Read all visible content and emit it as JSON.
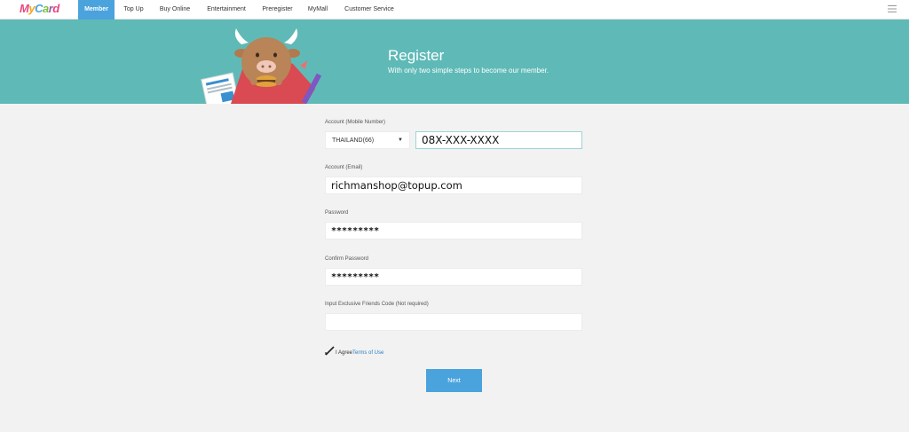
{
  "header": {
    "logo_text": "MyCard",
    "nav": [
      {
        "label": "Member",
        "active": true
      },
      {
        "label": "Top Up"
      },
      {
        "label": "Buy Online"
      },
      {
        "label": "Entertainment"
      },
      {
        "label": "Preregister"
      },
      {
        "label": "MyMall"
      },
      {
        "label": "Customer Service"
      }
    ],
    "menu_icon": "hamburger-icon"
  },
  "banner": {
    "title": "Register",
    "subtitle": "With only two simple steps to become our member.",
    "mascot_icon": "bull-mascot-icon"
  },
  "form": {
    "mobile": {
      "label": "Account (Mobile Number)",
      "country": "THAILAND(66)",
      "value": "08X-XXX-XXXX"
    },
    "email": {
      "label": "Account (Email)",
      "value": "richmanshop@topup.com"
    },
    "password": {
      "label": "Password",
      "value": "*********"
    },
    "confirm_password": {
      "label": "Confirm Password",
      "value": "*********"
    },
    "friends_code": {
      "label": "Input Exclusive Friends Code (Not required)",
      "value": ""
    },
    "agree": {
      "label": "I Agree",
      "link": "Terms of Use",
      "checked": true
    },
    "next_label": "Next"
  },
  "colors": {
    "accent": "#4aa3dc",
    "banner": "#5fbab7",
    "background": "#f2f2f2"
  }
}
